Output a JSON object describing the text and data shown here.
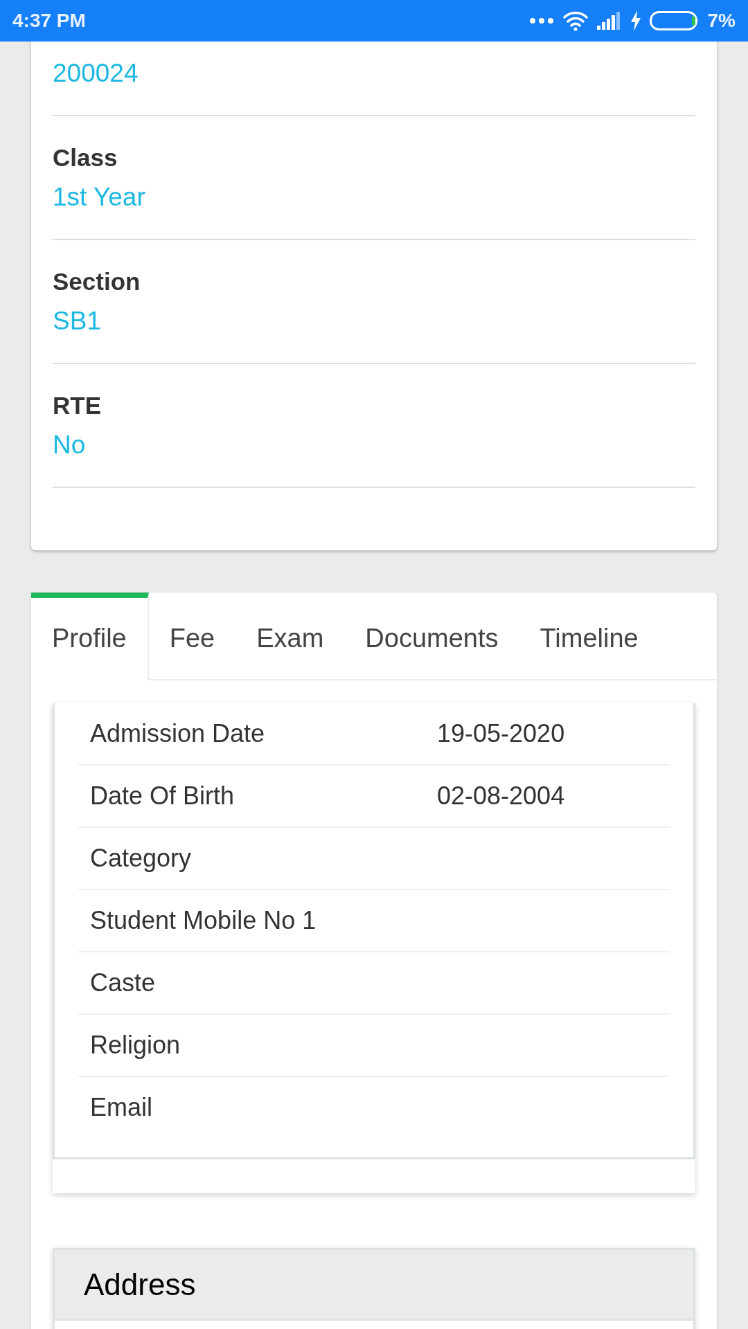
{
  "status_bar": {
    "time": "4:37 PM",
    "battery": "7%"
  },
  "student_info": {
    "fields": [
      {
        "value": "200024"
      },
      {
        "label": "Class",
        "value": "1st Year"
      },
      {
        "label": "Section",
        "value": "SB1"
      },
      {
        "label": "RTE",
        "value": "No"
      }
    ]
  },
  "tabs": [
    {
      "label": "Profile",
      "selected": true
    },
    {
      "label": "Fee",
      "selected": false
    },
    {
      "label": "Exam",
      "selected": false
    },
    {
      "label": "Documents",
      "selected": false
    },
    {
      "label": "Timeline",
      "selected": false
    }
  ],
  "profile": {
    "rows": [
      {
        "label": "Admission Date",
        "value": "19-05-2020"
      },
      {
        "label": "Date Of Birth",
        "value": "02-08-2004"
      },
      {
        "label": "Category"
      },
      {
        "label": "Student Mobile No 1"
      },
      {
        "label": "Caste"
      },
      {
        "label": "Religion"
      },
      {
        "label": "Email"
      }
    ]
  },
  "address": {
    "title": "Address"
  }
}
